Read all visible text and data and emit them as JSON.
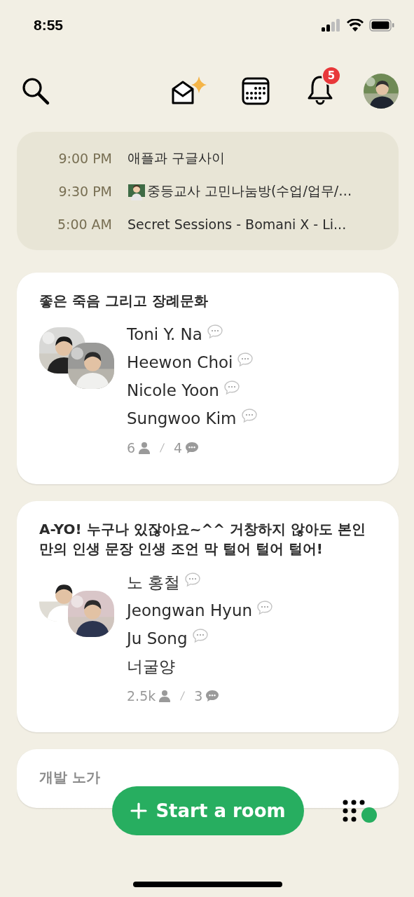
{
  "status_bar": {
    "time": "8:55"
  },
  "top_bar": {
    "notification_count": "5"
  },
  "upcoming": [
    {
      "time": "9:00 PM",
      "title": "애플과 구글사이",
      "leading_icon": false
    },
    {
      "time": "9:30 PM",
      "title": "중등교사 고민나눔방(수업/업무/…",
      "leading_icon": true
    },
    {
      "time": "5:00 AM",
      "title": "Secret Sessions - Bomani X - Li...",
      "leading_icon": false
    }
  ],
  "rooms": [
    {
      "title": "좋은 죽음 그리고 장례문화",
      "speakers": [
        {
          "name": "Toni Y. Na",
          "speaking": true
        },
        {
          "name": "Heewon Choi",
          "speaking": true
        },
        {
          "name": "Nicole Yoon",
          "speaking": true
        },
        {
          "name": "Sungwoo Kim",
          "speaking": true
        }
      ],
      "listeners": "6",
      "comments": "4"
    },
    {
      "title": "A-YO! 누구나 있잖아요~^^ 거창하지 않아도 본인 만의 인생 문장 인생 조언 막 털어 털어 털어!",
      "speakers": [
        {
          "name": "노 홍철",
          "speaking": true
        },
        {
          "name": "Jeongwan Hyun",
          "speaking": true
        },
        {
          "name": "Ju Song",
          "speaking": true
        },
        {
          "name": "너굴양",
          "speaking": false
        }
      ],
      "listeners": "2.5k",
      "comments": "3"
    },
    {
      "title": "개발 노가"
    }
  ],
  "action": {
    "label": "Start a room"
  }
}
